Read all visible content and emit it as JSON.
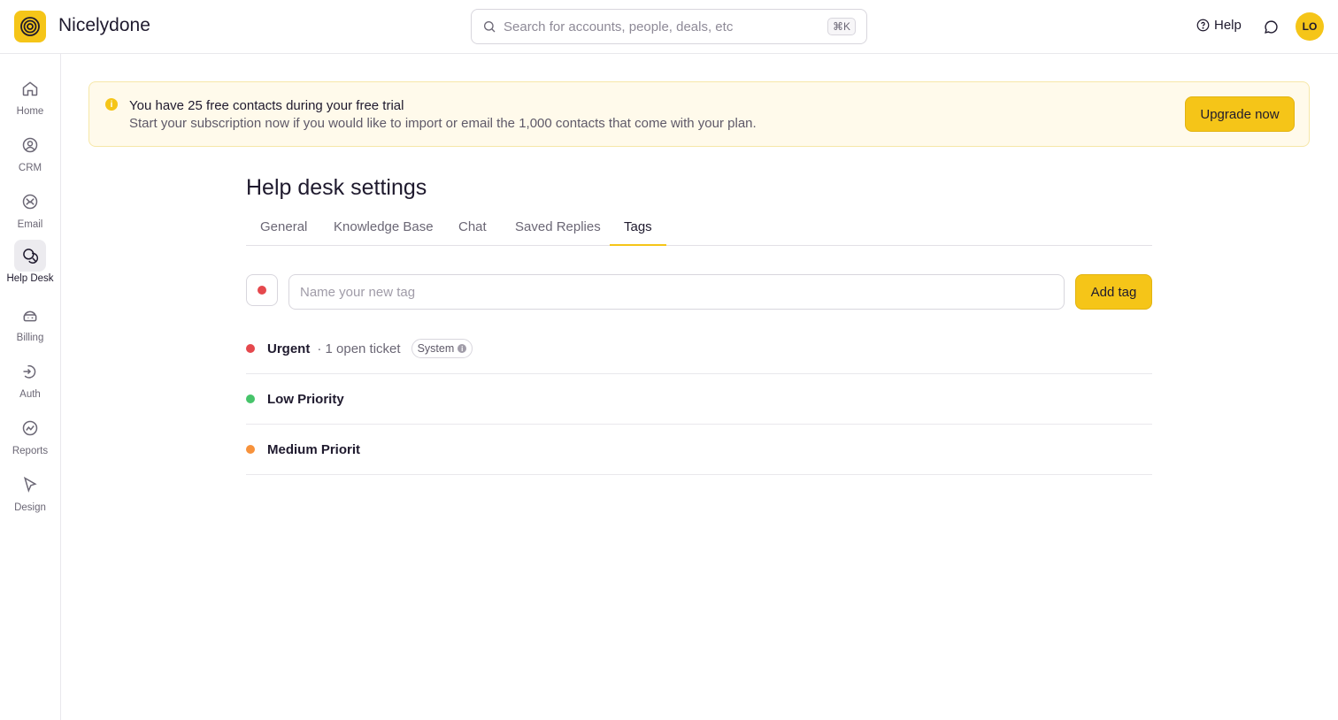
{
  "app": {
    "name": "Nicelydone"
  },
  "search": {
    "placeholder": "Search for accounts, people, deals, etc",
    "shortcut": "⌘K"
  },
  "header": {
    "help_label": "Help",
    "avatar_initials": "LO"
  },
  "sidebar": {
    "items": [
      {
        "label": "Home",
        "icon": "home-icon",
        "active": false
      },
      {
        "label": "CRM",
        "icon": "crm-icon",
        "active": false
      },
      {
        "label": "Email",
        "icon": "email-icon",
        "active": false
      },
      {
        "label": "Help Desk",
        "icon": "help-desk-icon",
        "active": true
      },
      {
        "label": "Billing",
        "icon": "billing-icon",
        "active": false
      },
      {
        "label": "Auth",
        "icon": "auth-icon",
        "active": false
      },
      {
        "label": "Reports",
        "icon": "reports-icon",
        "active": false
      },
      {
        "label": "Design",
        "icon": "design-icon",
        "active": false
      }
    ]
  },
  "banner": {
    "title": "You have 25 free contacts during your free trial",
    "text": "Start your subscription now if you would like to import or email the 1,000 contacts that come with your plan.",
    "button_label": "Upgrade now"
  },
  "main": {
    "title": "Help desk settings",
    "tabs": [
      {
        "label": "General",
        "active": false
      },
      {
        "label": "Knowledge Base",
        "active": false
      },
      {
        "label": "Chat",
        "active": false
      },
      {
        "label": "Saved Replies",
        "active": false
      },
      {
        "label": "Tags",
        "active": true
      }
    ],
    "new_tag": {
      "placeholder": "Name your new tag",
      "selected_color": "#e5484d",
      "button_label": "Add tag"
    },
    "tags": [
      {
        "name": "Urgent",
        "color": "#e5484d",
        "meta": "· 1 open ticket",
        "badge": "System"
      },
      {
        "name": "Low Priority",
        "color": "#46c46a"
      },
      {
        "name": "Medium Priorit",
        "color": "#f7923b"
      }
    ]
  },
  "colors": {
    "accent": "#f5c518",
    "banner_bg": "#fffaeb"
  }
}
